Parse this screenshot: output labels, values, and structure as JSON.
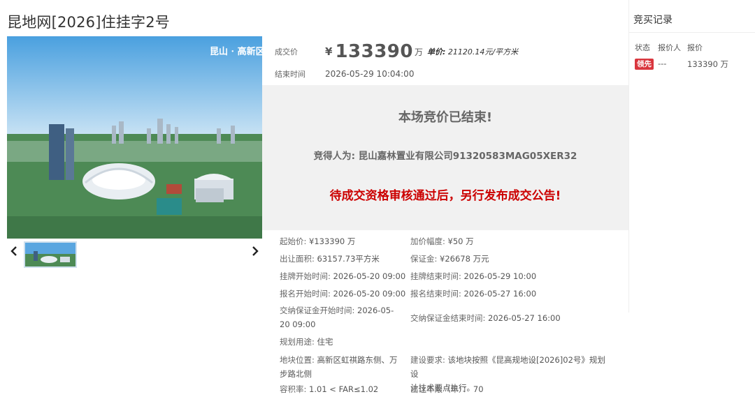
{
  "page": {
    "title": "昆地网[2026]住挂字2号"
  },
  "image": {
    "watermark": "昆山 · 高新区"
  },
  "price": {
    "label": "成交价",
    "currency": "¥",
    "value": "133390",
    "unit": "万",
    "unit_price_label": "单价:",
    "unit_price_value": "21120.14元/平方米"
  },
  "end_time": {
    "label": "结束时间",
    "value": "2026-05-29 10:04:00"
  },
  "result": {
    "title": "本场竞价已结束!",
    "winner": "竞得人为: 昆山嘉林置业有限公司91320583MAG05XER32",
    "notice": "待成交资格审核通过后，另行发布成交公告!"
  },
  "details": {
    "start_price": {
      "label": "起始价:",
      "value": "¥133390 万"
    },
    "increment": {
      "label": "加价幅度:",
      "value": "¥50 万"
    },
    "area": {
      "label": "出让面积:",
      "value": "63157.73平方米"
    },
    "deposit": {
      "label": "保证金:",
      "value": "¥26678 万元"
    },
    "listing_start": {
      "label": "挂牌开始时间:",
      "value": "2026-05-20 09:00"
    },
    "listing_end": {
      "label": "挂牌结束时间:",
      "value": "2026-05-29 10:00"
    },
    "reg_start": {
      "label": "报名开始时间:",
      "value": "2026-05-20 09:00"
    },
    "reg_end": {
      "label": "报名结束时间:",
      "value": "2026-05-27 16:00"
    },
    "deposit_start": {
      "label": "交纳保证金开始时间:",
      "value_line1": "2026-05-",
      "value_line2": "20 09:00"
    },
    "deposit_end": {
      "label": "交纳保证金结束时间:",
      "value": "2026-05-27 16:00"
    },
    "usage": {
      "label": "规划用途:",
      "value": "住宅"
    },
    "location": {
      "label": "地块位置:",
      "value_line1": "高新区虹祺路东侧、万",
      "value_line2": "步路北侧"
    },
    "requirement": {
      "label": "建设要求:",
      "value_line1": "该地块按照《昆高规地设[2026]02号》规划设",
      "value_line2": "计技术要点执行。"
    },
    "far": {
      "label": "容积率:",
      "value": "1.01 < FAR≤1.02"
    },
    "term": {
      "label": "出让年限（年）：",
      "value": "70"
    }
  },
  "bid_record": {
    "title": "竞买记录",
    "columns": [
      "状态",
      "报价人",
      "报价"
    ],
    "rows": [
      {
        "status": "领先",
        "bidder": "---",
        "price": "133390 万"
      }
    ]
  },
  "colors": {
    "accent_red": "#cc0000",
    "badge_red": "#d9363e",
    "result_bg": "#f1f1f1"
  },
  "icons": {
    "prev": "chevron-left-icon",
    "next": "chevron-right-icon"
  }
}
